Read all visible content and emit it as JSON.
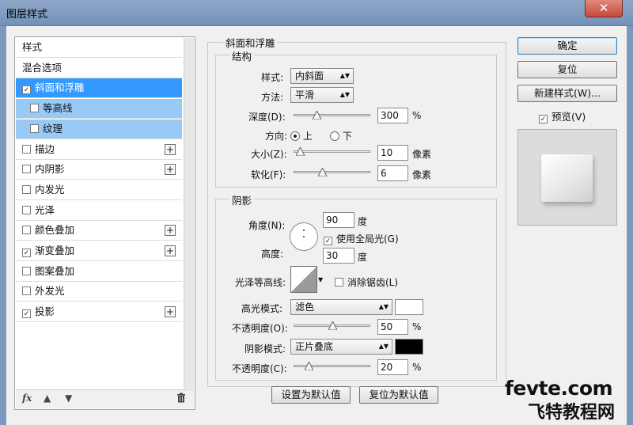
{
  "window": {
    "title": "图层样式",
    "close_label": "✕"
  },
  "left_list": {
    "items": [
      {
        "label": "样式",
        "checkbox": false,
        "checked": false,
        "plus": false,
        "state": "normal"
      },
      {
        "label": "混合选项",
        "checkbox": false,
        "checked": false,
        "plus": false,
        "state": "normal"
      },
      {
        "label": "斜面和浮雕",
        "checkbox": true,
        "checked": true,
        "plus": false,
        "state": "selected"
      },
      {
        "label": "等高线",
        "checkbox": true,
        "checked": false,
        "plus": false,
        "state": "sub"
      },
      {
        "label": "纹理",
        "checkbox": true,
        "checked": false,
        "plus": false,
        "state": "sub"
      },
      {
        "label": "描边",
        "checkbox": true,
        "checked": false,
        "plus": true,
        "state": "normal"
      },
      {
        "label": "内阴影",
        "checkbox": true,
        "checked": false,
        "plus": true,
        "state": "normal"
      },
      {
        "label": "内发光",
        "checkbox": true,
        "checked": false,
        "plus": false,
        "state": "normal"
      },
      {
        "label": "光泽",
        "checkbox": true,
        "checked": false,
        "plus": false,
        "state": "normal"
      },
      {
        "label": "颜色叠加",
        "checkbox": true,
        "checked": false,
        "plus": true,
        "state": "normal"
      },
      {
        "label": "渐变叠加",
        "checkbox": true,
        "checked": true,
        "plus": true,
        "state": "normal"
      },
      {
        "label": "图案叠加",
        "checkbox": true,
        "checked": false,
        "plus": false,
        "state": "normal"
      },
      {
        "label": "外发光",
        "checkbox": true,
        "checked": false,
        "plus": false,
        "state": "normal"
      },
      {
        "label": "投影",
        "checkbox": true,
        "checked": true,
        "plus": true,
        "state": "normal"
      }
    ],
    "footer": {
      "fx_label": "fx",
      "up_icon": "arrow-up-icon",
      "down_icon": "arrow-down-icon",
      "trash_icon": "trash-icon"
    }
  },
  "bevel": {
    "group_title": "斜面和浮雕",
    "structure": {
      "title": "结构",
      "style_label": "样式:",
      "style_value": "内斜面",
      "technique_label": "方法:",
      "technique_value": "平滑",
      "depth_label": "深度(D):",
      "depth_value": "300",
      "depth_unit": "%",
      "depth_slider": 0.3,
      "direction_label": "方向:",
      "direction_up": "上",
      "direction_down": "下",
      "direction_selected": "上",
      "size_label": "大小(Z):",
      "size_value": "10",
      "size_unit": "像素",
      "size_slider": 0.08,
      "soften_label": "软化(F):",
      "soften_value": "6",
      "soften_unit": "像素",
      "soften_slider": 0.37
    },
    "shading": {
      "title": "阴影",
      "angle_label": "角度(N):",
      "angle_value": "90",
      "angle_unit": "度",
      "global_light_label": "使用全局光(G)",
      "global_light_checked": true,
      "altitude_label": "高度:",
      "altitude_value": "30",
      "altitude_unit": "度",
      "gloss_contour_label": "光泽等高线:",
      "anti_alias_label": "消除锯齿(L)",
      "anti_alias_checked": false,
      "highlight_mode_label": "高光模式:",
      "highlight_mode_value": "滤色",
      "highlight_color": "#ffffff",
      "highlight_opacity_label": "不透明度(O):",
      "highlight_opacity_value": "50",
      "highlight_opacity_unit": "%",
      "highlight_opacity_slider": 0.5,
      "shadow_mode_label": "阴影模式:",
      "shadow_mode_value": "正片叠底",
      "shadow_color": "#000000",
      "shadow_opacity_label": "不透明度(C):",
      "shadow_opacity_value": "20",
      "shadow_opacity_unit": "%",
      "shadow_opacity_slider": 0.2
    },
    "set_default_label": "设置为默认值",
    "reset_default_label": "复位为默认值"
  },
  "right": {
    "ok_label": "确定",
    "reset_label": "复位",
    "new_style_label": "新建样式(W)...",
    "preview_label": "预览(V)",
    "preview_checked": true
  },
  "watermark": {
    "line1": "fevte.com",
    "line2": "飞特教程网"
  }
}
